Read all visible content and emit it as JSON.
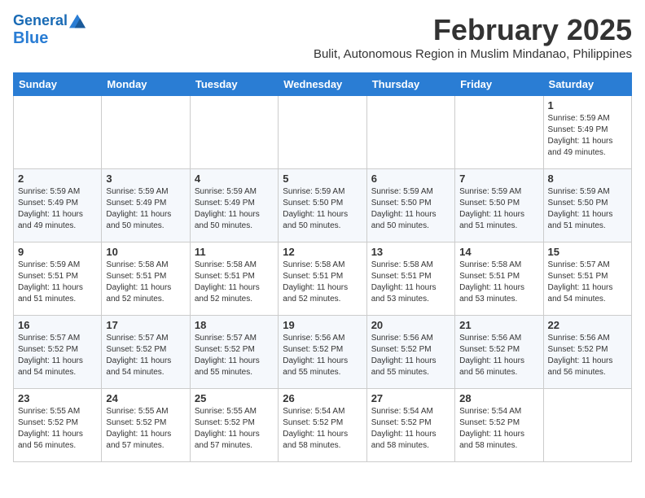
{
  "header": {
    "logo_line1": "General",
    "logo_line2": "Blue",
    "title": "February 2025",
    "subtitle": "Bulit, Autonomous Region in Muslim Mindanao, Philippines"
  },
  "weekdays": [
    "Sunday",
    "Monday",
    "Tuesday",
    "Wednesday",
    "Thursday",
    "Friday",
    "Saturday"
  ],
  "weeks": [
    [
      {
        "day": "",
        "info": ""
      },
      {
        "day": "",
        "info": ""
      },
      {
        "day": "",
        "info": ""
      },
      {
        "day": "",
        "info": ""
      },
      {
        "day": "",
        "info": ""
      },
      {
        "day": "",
        "info": ""
      },
      {
        "day": "1",
        "info": "Sunrise: 5:59 AM\nSunset: 5:49 PM\nDaylight: 11 hours\nand 49 minutes."
      }
    ],
    [
      {
        "day": "2",
        "info": "Sunrise: 5:59 AM\nSunset: 5:49 PM\nDaylight: 11 hours\nand 49 minutes."
      },
      {
        "day": "3",
        "info": "Sunrise: 5:59 AM\nSunset: 5:49 PM\nDaylight: 11 hours\nand 50 minutes."
      },
      {
        "day": "4",
        "info": "Sunrise: 5:59 AM\nSunset: 5:49 PM\nDaylight: 11 hours\nand 50 minutes."
      },
      {
        "day": "5",
        "info": "Sunrise: 5:59 AM\nSunset: 5:50 PM\nDaylight: 11 hours\nand 50 minutes."
      },
      {
        "day": "6",
        "info": "Sunrise: 5:59 AM\nSunset: 5:50 PM\nDaylight: 11 hours\nand 50 minutes."
      },
      {
        "day": "7",
        "info": "Sunrise: 5:59 AM\nSunset: 5:50 PM\nDaylight: 11 hours\nand 51 minutes."
      },
      {
        "day": "8",
        "info": "Sunrise: 5:59 AM\nSunset: 5:50 PM\nDaylight: 11 hours\nand 51 minutes."
      }
    ],
    [
      {
        "day": "9",
        "info": "Sunrise: 5:59 AM\nSunset: 5:51 PM\nDaylight: 11 hours\nand 51 minutes."
      },
      {
        "day": "10",
        "info": "Sunrise: 5:58 AM\nSunset: 5:51 PM\nDaylight: 11 hours\nand 52 minutes."
      },
      {
        "day": "11",
        "info": "Sunrise: 5:58 AM\nSunset: 5:51 PM\nDaylight: 11 hours\nand 52 minutes."
      },
      {
        "day": "12",
        "info": "Sunrise: 5:58 AM\nSunset: 5:51 PM\nDaylight: 11 hours\nand 52 minutes."
      },
      {
        "day": "13",
        "info": "Sunrise: 5:58 AM\nSunset: 5:51 PM\nDaylight: 11 hours\nand 53 minutes."
      },
      {
        "day": "14",
        "info": "Sunrise: 5:58 AM\nSunset: 5:51 PM\nDaylight: 11 hours\nand 53 minutes."
      },
      {
        "day": "15",
        "info": "Sunrise: 5:57 AM\nSunset: 5:51 PM\nDaylight: 11 hours\nand 54 minutes."
      }
    ],
    [
      {
        "day": "16",
        "info": "Sunrise: 5:57 AM\nSunset: 5:52 PM\nDaylight: 11 hours\nand 54 minutes."
      },
      {
        "day": "17",
        "info": "Sunrise: 5:57 AM\nSunset: 5:52 PM\nDaylight: 11 hours\nand 54 minutes."
      },
      {
        "day": "18",
        "info": "Sunrise: 5:57 AM\nSunset: 5:52 PM\nDaylight: 11 hours\nand 55 minutes."
      },
      {
        "day": "19",
        "info": "Sunrise: 5:56 AM\nSunset: 5:52 PM\nDaylight: 11 hours\nand 55 minutes."
      },
      {
        "day": "20",
        "info": "Sunrise: 5:56 AM\nSunset: 5:52 PM\nDaylight: 11 hours\nand 55 minutes."
      },
      {
        "day": "21",
        "info": "Sunrise: 5:56 AM\nSunset: 5:52 PM\nDaylight: 11 hours\nand 56 minutes."
      },
      {
        "day": "22",
        "info": "Sunrise: 5:56 AM\nSunset: 5:52 PM\nDaylight: 11 hours\nand 56 minutes."
      }
    ],
    [
      {
        "day": "23",
        "info": "Sunrise: 5:55 AM\nSunset: 5:52 PM\nDaylight: 11 hours\nand 56 minutes."
      },
      {
        "day": "24",
        "info": "Sunrise: 5:55 AM\nSunset: 5:52 PM\nDaylight: 11 hours\nand 57 minutes."
      },
      {
        "day": "25",
        "info": "Sunrise: 5:55 AM\nSunset: 5:52 PM\nDaylight: 11 hours\nand 57 minutes."
      },
      {
        "day": "26",
        "info": "Sunrise: 5:54 AM\nSunset: 5:52 PM\nDaylight: 11 hours\nand 58 minutes."
      },
      {
        "day": "27",
        "info": "Sunrise: 5:54 AM\nSunset: 5:52 PM\nDaylight: 11 hours\nand 58 minutes."
      },
      {
        "day": "28",
        "info": "Sunrise: 5:54 AM\nSunset: 5:52 PM\nDaylight: 11 hours\nand 58 minutes."
      },
      {
        "day": "",
        "info": ""
      }
    ]
  ]
}
